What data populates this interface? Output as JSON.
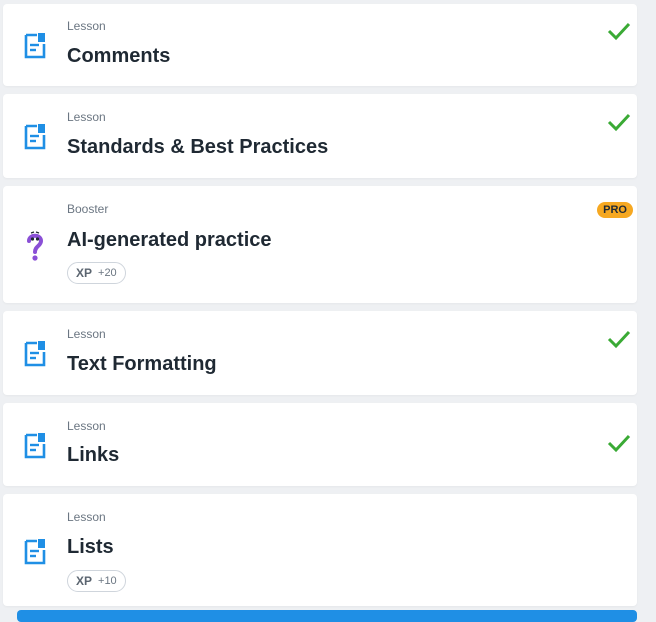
{
  "items": [
    {
      "type": "Lesson",
      "title": "Comments",
      "status": "completed",
      "icon": "document-icon"
    },
    {
      "type": "Lesson",
      "title": "Standards & Best Practices",
      "status": "completed",
      "icon": "document-icon"
    },
    {
      "type": "Booster",
      "title": "AI-generated practice",
      "badge": "PRO",
      "xp_label": "XP",
      "xp_value": "+20",
      "icon": "question-mark-icon"
    },
    {
      "type": "Lesson",
      "title": "Text Formatting",
      "status": "completed",
      "icon": "document-icon"
    },
    {
      "type": "Lesson",
      "title": "Links",
      "status": "completed",
      "icon": "document-icon"
    },
    {
      "type": "Lesson",
      "title": "Lists",
      "xp_label": "XP",
      "xp_value": "+10",
      "icon": "document-icon"
    }
  ],
  "colors": {
    "accent_blue": "#1f8fe5",
    "check_green": "#3aaa35",
    "pro_orange": "#f6a821",
    "booster_purple": "#8a4fd6"
  }
}
